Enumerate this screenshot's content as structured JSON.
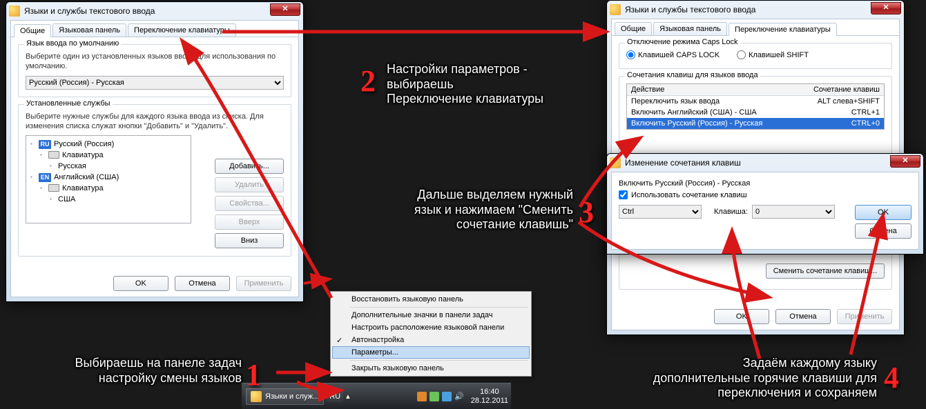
{
  "left_window": {
    "title": "Языки и службы текстового ввода",
    "tabs": [
      "Общие",
      "Языковая панель",
      "Переключение клавиатуры"
    ],
    "active_tab": 0,
    "default_lang_group": "Язык ввода по умолчанию",
    "default_lang_help": "Выберите один из установленных языков ввода для использования по умолчанию.",
    "default_lang_value": "Русский (Россия) - Русская",
    "services_group": "Установленные службы",
    "services_help": "Выберите нужные службы для каждого языка ввода из списка. Для изменения списка служат кнопки \"Добавить\" и \"Удалить\".",
    "tree": {
      "ru_badge": "RU",
      "ru_label": "Русский (Россия)",
      "ru_kb": "Клавиатура",
      "ru_layout": "Русская",
      "en_badge": "EN",
      "en_label": "Английский (США)",
      "en_kb": "Клавиатура",
      "en_layout": "США"
    },
    "buttons": {
      "add": "Добавить...",
      "remove": "Удалить",
      "props": "Свойства...",
      "up": "Вверх",
      "down": "Вниз"
    },
    "ok": "OK",
    "cancel": "Отмена",
    "apply": "Применить"
  },
  "right_window": {
    "title": "Языки и службы текстового ввода",
    "tabs": [
      "Общие",
      "Языковая панель",
      "Переключение клавиатуры"
    ],
    "active_tab": 2,
    "caps_group": "Отключение режима Caps Lock",
    "caps_opt1": "Клавишей CAPS LOCK",
    "caps_opt2": "Клавишей SHIFT",
    "hotkeys_group": "Сочетания клавиш для языков ввода",
    "col_action": "Действие",
    "col_shortcut": "Сочетание клавиш",
    "rows": [
      {
        "action": "Переключить язык ввода",
        "shortcut": "ALT слева+SHIFT"
      },
      {
        "action": "Включить Английский (США) - США",
        "shortcut": "CTRL+1"
      },
      {
        "action": "Включить Русский (Россия) - Русская",
        "shortcut": "CTRL+0"
      }
    ],
    "change_btn": "Сменить сочетание клавиш...",
    "ok": "OK",
    "cancel": "Отмена",
    "apply": "Применить"
  },
  "change_dialog": {
    "title": "Изменение сочетания клавиш",
    "lang": "Включить Русский (Россия) - Русская",
    "use_shortcut": "Использовать сочетание клавиш",
    "mod": "Ctrl",
    "key_label": "Клавиша:",
    "key": "0",
    "ok": "OK",
    "cancel": "Отмена"
  },
  "context_menu": {
    "items": [
      "Восстановить языковую панель",
      "Дополнительные значки в панели задач",
      "Настроить расположение языковой панели",
      "Автонастройка",
      "Параметры...",
      "Закрыть языковую панель"
    ],
    "checked_index": 3,
    "selected_index": 4
  },
  "taskbar": {
    "app": "Языки и служ...",
    "lang": "RU",
    "time": "16:40",
    "date": "28.12.2011"
  },
  "annotations": {
    "step1": "Выбираешь на панеле задач\nнастройку смены языков",
    "step2": "Настройки параметров -\nвыбираешь\nПереключение клавиатуры",
    "step3": "Дальше выделяем нужный\nязык и  нажимаем \"Сменить\nсочетание клавишь\"",
    "step4": "Задаём каждому языку\nдополнительные горячие клавиши для\nпереключения и сохраняем"
  },
  "numbers": {
    "n1": "1",
    "n2": "2",
    "n3": "3",
    "n4": "4"
  }
}
